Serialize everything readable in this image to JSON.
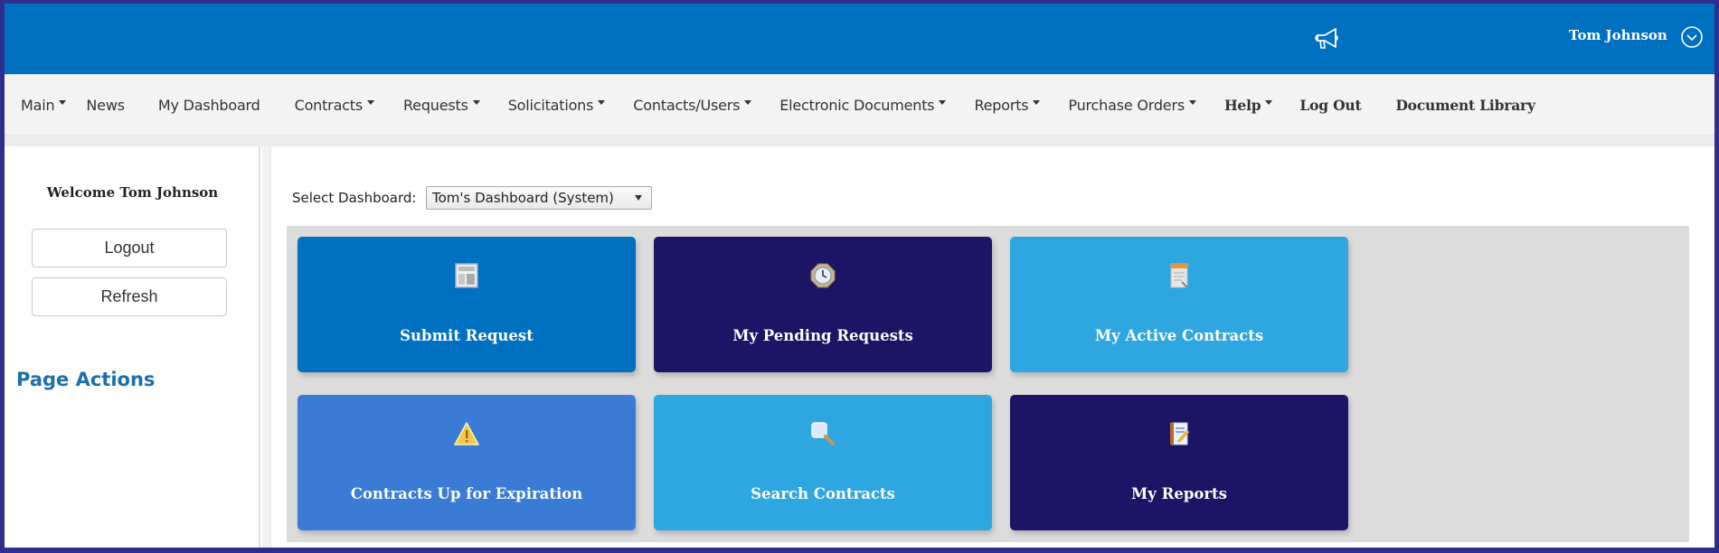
{
  "header": {
    "user_name": "Tom Johnson",
    "announce_icon": "megaphone-icon",
    "user_menu_icon": "chevron-down-circle-icon",
    "color": "#0070c0"
  },
  "nav": {
    "items": [
      {
        "label": "Main",
        "dropdown": true
      },
      {
        "label": "News",
        "dropdown": false
      },
      {
        "label": "My Dashboard",
        "dropdown": false
      },
      {
        "label": "Contracts",
        "dropdown": true
      },
      {
        "label": "Requests",
        "dropdown": true
      },
      {
        "label": "Solicitations",
        "dropdown": true
      },
      {
        "label": "Contacts/Users",
        "dropdown": true
      },
      {
        "label": "Electronic Documents",
        "dropdown": true
      },
      {
        "label": "Reports",
        "dropdown": true
      },
      {
        "label": "Purchase Orders",
        "dropdown": true
      },
      {
        "label": "Help",
        "dropdown": true
      },
      {
        "label": "Log Out",
        "dropdown": false
      },
      {
        "label": "Document Library",
        "dropdown": false
      }
    ]
  },
  "sidebar": {
    "welcome": "Welcome Tom Johnson",
    "logout_label": "Logout",
    "refresh_label": "Refresh",
    "page_actions": "Page Actions"
  },
  "dashboard": {
    "select_label": "Select Dashboard:",
    "selected": "Tom's Dashboard (System)",
    "tiles": [
      {
        "label": "Submit Request",
        "icon": "form-icon",
        "color": "#0070c0"
      },
      {
        "label": "My Pending Requests",
        "icon": "clock-icon",
        "color": "#1c1464"
      },
      {
        "label": "My Active Contracts",
        "icon": "contract-document-icon",
        "color": "#2ea7e0"
      },
      {
        "label": "Contracts Up for Expiration",
        "icon": "warning-icon",
        "color": "#3a7bd5"
      },
      {
        "label": "Search Contracts",
        "icon": "magnifier-icon",
        "color": "#2ea7e0"
      },
      {
        "label": "My Reports",
        "icon": "notebook-pencil-icon",
        "color": "#1c1464"
      }
    ]
  }
}
